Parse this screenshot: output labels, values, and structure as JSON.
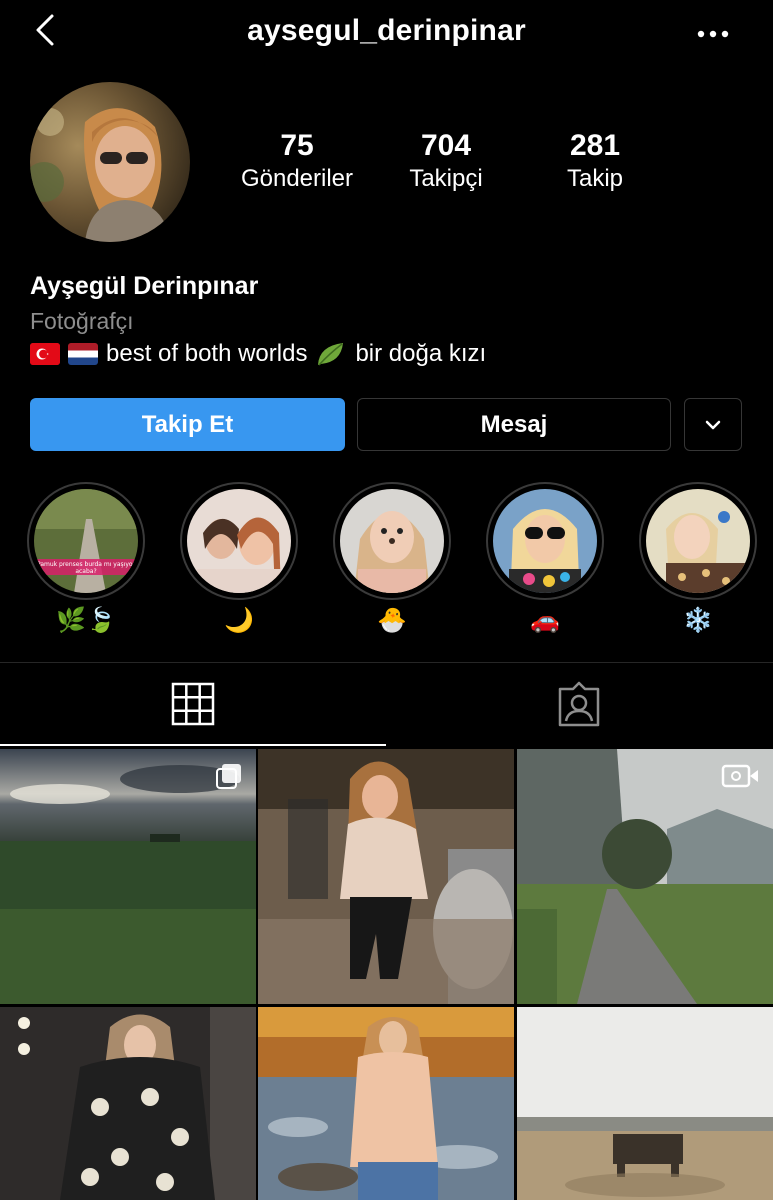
{
  "header": {
    "username": "aysegul_derinpinar",
    "back_icon": "chevron-left-icon",
    "more_icon": "more-horizontal-icon"
  },
  "profile": {
    "stats": [
      {
        "value": "75",
        "label": "Gönderiler"
      },
      {
        "value": "704",
        "label": "Takipçi"
      },
      {
        "value": "281",
        "label": "Takip"
      }
    ],
    "name": "Ayşegül Derinpınar",
    "category": "Fotoğrafçı",
    "bio_text": "best of both worlds",
    "bio_text_2": "bir doğa kızı",
    "bio_emojis": [
      "turkey-flag",
      "netherlands-flag",
      "leaf"
    ]
  },
  "actions": {
    "follow_label": "Takip Et",
    "message_label": "Mesaj",
    "dropdown_icon": "chevron-down-icon"
  },
  "highlights": [
    {
      "label": "🌿🍃",
      "cover_caption": "Pamuk prenses burda mı yaşıyor acaba?"
    },
    {
      "label": "🌙"
    },
    {
      "label": "🐣"
    },
    {
      "label": "🚗"
    },
    {
      "label": "❄️"
    }
  ],
  "tabs": [
    {
      "name": "posts-grid",
      "icon": "grid-icon",
      "active": true
    },
    {
      "name": "tagged",
      "icon": "tagged-person-icon",
      "active": false
    }
  ],
  "colors": {
    "background": "#000000",
    "accent": "#3897f0",
    "muted_text": "#8e8e8e",
    "border": "#363636"
  },
  "posts": [
    {
      "kind": "carousel",
      "badge_icon": "carousel-icon"
    },
    {
      "kind": "photo"
    },
    {
      "kind": "video",
      "badge_icon": "video-icon"
    },
    {
      "kind": "photo"
    },
    {
      "kind": "photo"
    },
    {
      "kind": "photo"
    }
  ]
}
